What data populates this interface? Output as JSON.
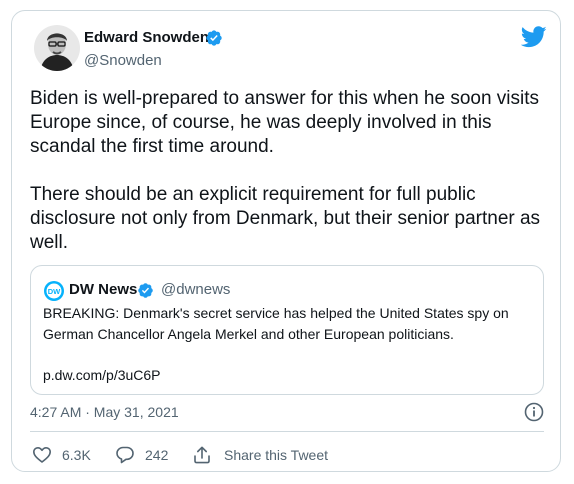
{
  "tweet": {
    "author": {
      "display_name": "Edward Snowden",
      "handle": "@Snowden",
      "verified": true
    },
    "text": [
      "Biden is well-prepared to answer for this when he soon visits Europe since, of course, he was deeply involved in this scandal the first time around.",
      "There should be an explicit requirement for full public disclosure not only from Denmark, but their senior partner as well."
    ],
    "quoted_tweet": {
      "display_name": "DW News",
      "handle": "@dwnews",
      "verified": true,
      "text": "BREAKING: Denmark's secret service has helped the United States spy on German Chancellor Angela Merkel and other European politicians.",
      "link": "p.dw.com/p/3uC6P"
    },
    "timestamp": "4:27 AM · May 31, 2021",
    "actions": {
      "likes": "6.3K",
      "replies": "242",
      "share_label": "Share this Tweet"
    }
  },
  "icons": {
    "logo": "twitter-bird-icon",
    "verified": "verified-badge-icon",
    "info": "info-icon",
    "like": "heart-icon",
    "reply": "reply-bubble-icon",
    "share": "share-icon"
  },
  "colors": {
    "accent": "#1d9bf0",
    "secondary_text": "#536471",
    "border": "#cfd9de",
    "dw_blue": "#05b2fc"
  }
}
